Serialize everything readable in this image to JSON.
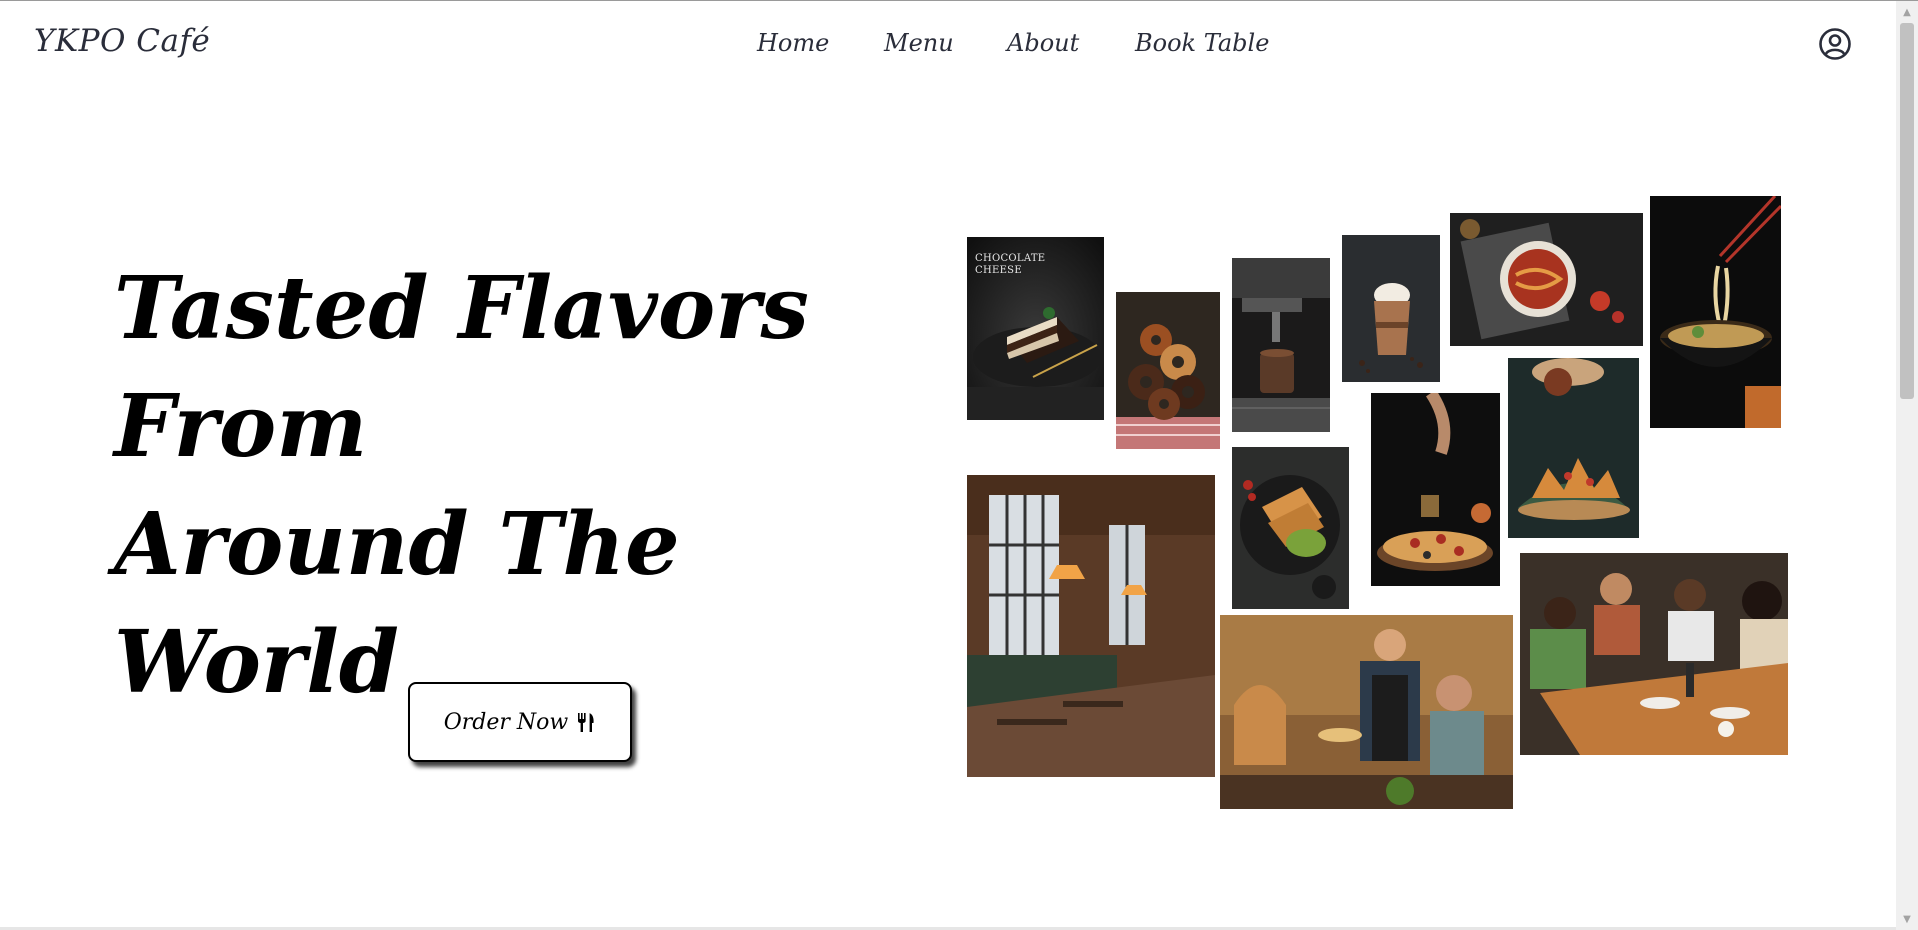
{
  "brand": {
    "name": "YKPO Café"
  },
  "nav": {
    "items": [
      {
        "label": "Home"
      },
      {
        "label": "Menu"
      },
      {
        "label": "About"
      },
      {
        "label": "Book Table"
      }
    ],
    "account_icon": "user-circle-icon"
  },
  "hero": {
    "title_line1": "Tasted Flavors From",
    "title_line2": "Around The World",
    "cta_label": "Order Now",
    "cta_icon": "utensils-icon"
  },
  "collage": {
    "cake_caption_line1": "CHOCOLATE",
    "cake_caption_line2": "CHEESE",
    "images": [
      "chocolate-cheese-cake",
      "donuts",
      "espresso-machine",
      "iced-mocha",
      "shrimp-pasta-bowl",
      "noodle-soup",
      "spiced-pastry-dish",
      "pizza",
      "baklava-plate",
      "restaurant-interior",
      "waiter-serving-guests",
      "friends-dining"
    ]
  },
  "colors": {
    "brand_text": "#2a2d3a",
    "hero_text": "#000000",
    "button_bg": "#ffffff"
  }
}
